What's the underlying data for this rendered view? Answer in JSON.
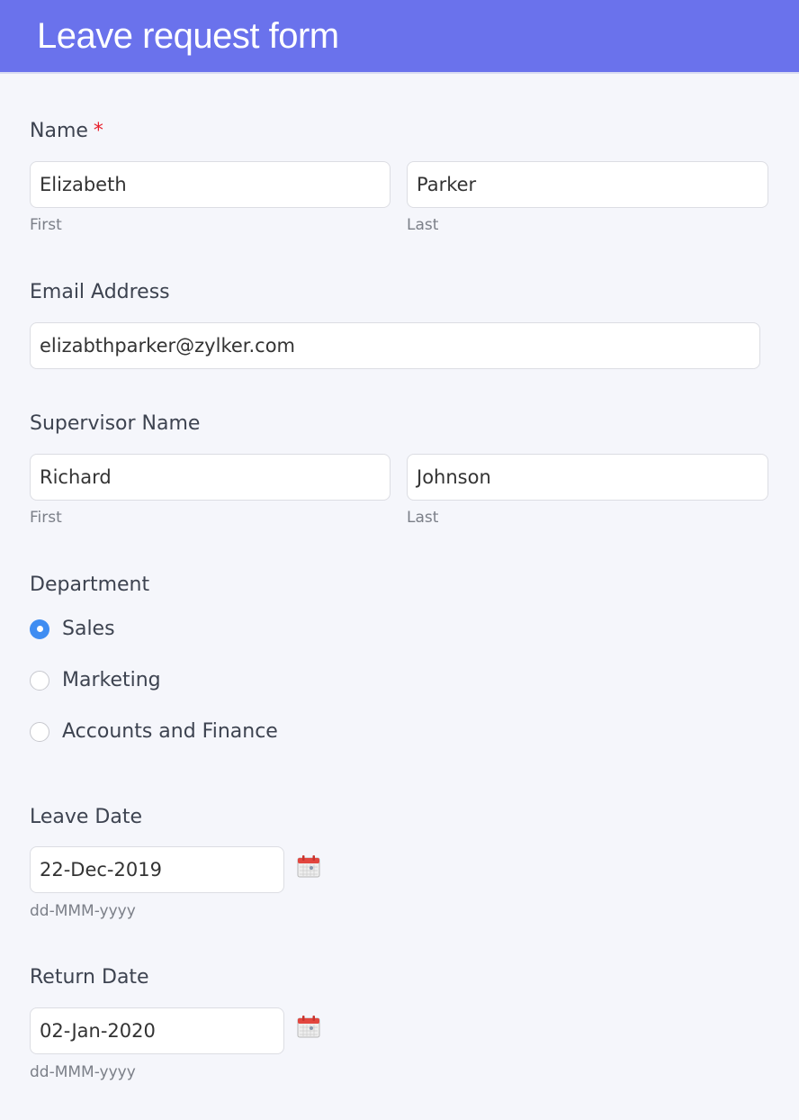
{
  "header": {
    "title": "Leave request form"
  },
  "colors": {
    "header_bg": "#6a72ec",
    "required": "#e8202c",
    "radio_checked": "#3f8df2"
  },
  "name": {
    "label": "Name",
    "required_mark": "*",
    "first": {
      "value": "Elizabeth",
      "sublabel": "First"
    },
    "last": {
      "value": "Parker",
      "sublabel": "Last"
    }
  },
  "email": {
    "label": "Email Address",
    "value": "elizabthparker@zylker.com"
  },
  "supervisor": {
    "label": "Supervisor Name",
    "first": {
      "value": "Richard",
      "sublabel": "First"
    },
    "last": {
      "value": "Johnson",
      "sublabel": "Last"
    }
  },
  "department": {
    "label": "Department",
    "options": [
      {
        "label": "Sales",
        "checked": true
      },
      {
        "label": "Marketing",
        "checked": false
      },
      {
        "label": "Accounts and Finance",
        "checked": false
      }
    ]
  },
  "leave_date": {
    "label": "Leave Date",
    "value": "22-Dec-2019",
    "format_hint": "dd-MMM-yyyy",
    "icon": "calendar-icon"
  },
  "return_date": {
    "label": "Return Date",
    "value": "02-Jan-2020",
    "format_hint": "dd-MMM-yyyy",
    "icon": "calendar-icon"
  }
}
